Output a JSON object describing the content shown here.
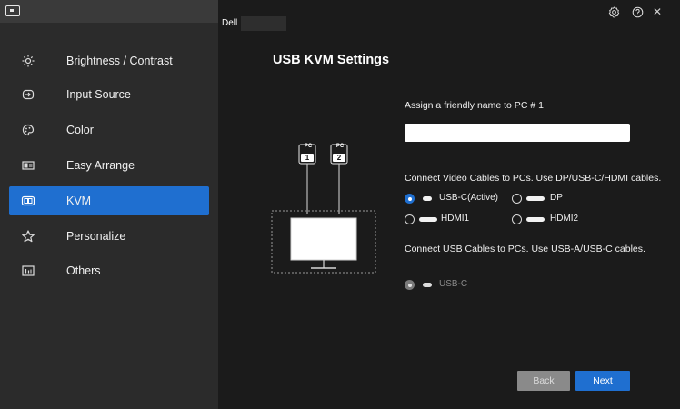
{
  "sidebar": {
    "items": [
      {
        "label": "Brightness / Contrast",
        "icon": "brightness-icon",
        "active": false
      },
      {
        "label": "Input Source",
        "icon": "input-source-icon",
        "active": false
      },
      {
        "label": "Color",
        "icon": "color-palette-icon",
        "active": false
      },
      {
        "label": "Easy Arrange",
        "icon": "easy-arrange-icon",
        "active": false
      },
      {
        "label": "KVM",
        "icon": "kvm-icon",
        "active": true
      },
      {
        "label": "Personalize",
        "icon": "star-icon",
        "active": false
      },
      {
        "label": "Others",
        "icon": "others-icon",
        "active": false
      }
    ]
  },
  "header": {
    "model_label": "Dell"
  },
  "main": {
    "title": "USB KVM Settings",
    "diagram": {
      "pc1_top": "PC",
      "pc1_num": "1",
      "pc2_top": "PC",
      "pc2_num": "2"
    },
    "friendly_name_label": "Assign a friendly name to PC # 1",
    "friendly_name_value": "",
    "video_label": "Connect Video Cables to PCs. Use DP/USB-C/HDMI cables.",
    "video_options": [
      {
        "label": "USB-C(Active)",
        "selected": true
      },
      {
        "label": "DP",
        "selected": false
      },
      {
        "label": "HDMI1",
        "selected": false
      },
      {
        "label": "HDMI2",
        "selected": false
      }
    ],
    "usb_label": "Connect USB Cables to PCs. Use USB-A/USB-C cables.",
    "usb_option": {
      "label": "USB-C",
      "selected": true,
      "disabled": true
    },
    "back_label": "Back",
    "next_label": "Next"
  },
  "colors": {
    "accent": "#1f6fd0",
    "sidebar_bg": "#2b2b2b",
    "main_bg": "#1b1b1b"
  }
}
